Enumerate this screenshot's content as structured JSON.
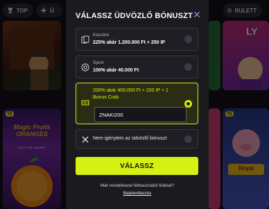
{
  "background": {
    "nav": [
      {
        "label": "TOP",
        "icon": "trophy-icon"
      },
      {
        "label": "Ú",
        "icon": "sparkle-icon"
      },
      {
        "label": "RULETT",
        "icon": "roulette-icon"
      }
    ],
    "badge": "Új",
    "tiles": [
      {
        "logo": "Magic Fruits ORANGES",
        "sub": "HOLD THE JACKPOT"
      },
      {
        "logo": "Royal",
        "sub": ""
      }
    ]
  },
  "modal": {
    "title": "VÁLASSZ ÜDVÖZLŐ BÓNUSZT",
    "close_icon": "close-icon",
    "options": [
      {
        "category": "Kaszinó",
        "value": "225% akár 1.200.000 Ft + 250 IP",
        "icon": "cards-icon",
        "selected": false
      },
      {
        "category": "Sport",
        "value": "100% akár 40.000 Ft",
        "icon": "football-icon",
        "selected": false
      },
      {
        "category": "",
        "value": "200% akár 400.000 Ft + 200 IP + 1 Bonus Crab",
        "icon": "ticket-icon",
        "selected": true
      },
      {
        "category": "",
        "value": "Nem igénylem az üdvözlő bónuszt",
        "icon": "x-icon",
        "selected": false
      }
    ],
    "promo_code": "ZNAKI200",
    "cta": "VÁLASSZ",
    "login_prompt": "Már rendelkezel felhasználói fiókkal?",
    "login_link": "Bejelentkezés"
  },
  "colors": {
    "accent": "#d5f012",
    "close": "#8b87e6",
    "modal_bg": "#1b1a1f"
  }
}
